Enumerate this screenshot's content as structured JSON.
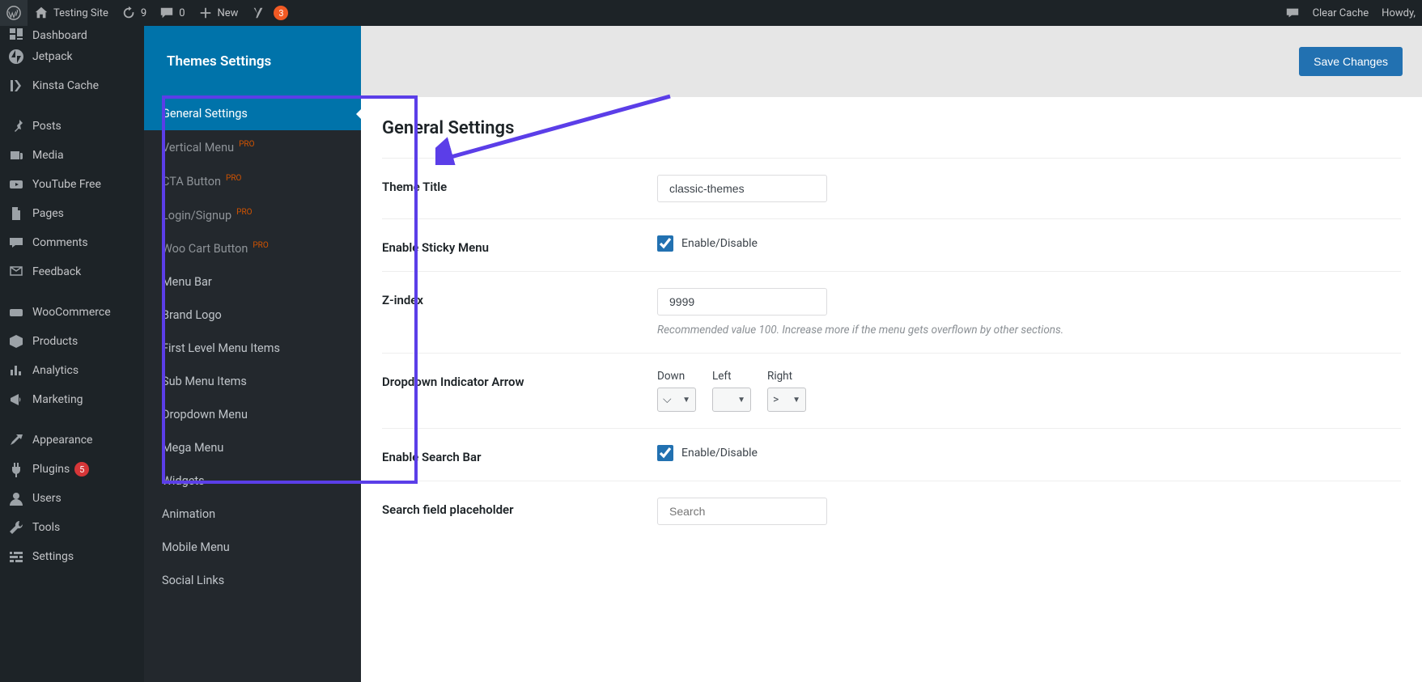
{
  "adminbar": {
    "site_name": "Testing Site",
    "updates_count": "9",
    "comments_count": "0",
    "new_label": "New",
    "yoast_count": "3",
    "clear_cache": "Clear Cache",
    "howdy": "Howdy,"
  },
  "adminmenu": {
    "items": [
      {
        "label": "Dashboard",
        "icon": "dashboard"
      },
      {
        "label": "Jetpack",
        "icon": "jetpack"
      },
      {
        "label": "Kinsta Cache",
        "icon": "kinsta"
      },
      {
        "label": "Posts",
        "icon": "pin"
      },
      {
        "label": "Media",
        "icon": "media"
      },
      {
        "label": "YouTube Free",
        "icon": "youtube"
      },
      {
        "label": "Pages",
        "icon": "pages"
      },
      {
        "label": "Comments",
        "icon": "comments"
      },
      {
        "label": "Feedback",
        "icon": "feedback"
      },
      {
        "label": "WooCommerce",
        "icon": "woo"
      },
      {
        "label": "Products",
        "icon": "products"
      },
      {
        "label": "Analytics",
        "icon": "analytics"
      },
      {
        "label": "Marketing",
        "icon": "marketing"
      },
      {
        "label": "Appearance",
        "icon": "appearance"
      },
      {
        "label": "Plugins",
        "icon": "plugins",
        "badge": "5"
      },
      {
        "label": "Users",
        "icon": "users"
      },
      {
        "label": "Tools",
        "icon": "tools"
      },
      {
        "label": "Settings",
        "icon": "settings"
      }
    ]
  },
  "themes_panel": {
    "title": "Themes Settings",
    "save_button": "Save Changes",
    "tabs": [
      {
        "label": "General Settings",
        "active": true
      },
      {
        "label": "Vertical Menu",
        "pro": true
      },
      {
        "label": "CTA Button",
        "pro": true
      },
      {
        "label": "Login/Signup",
        "pro": true
      },
      {
        "label": "Woo Cart Button",
        "pro": true
      },
      {
        "label": "Menu Bar"
      },
      {
        "label": "Brand Logo"
      },
      {
        "label": "First Level Menu Items"
      },
      {
        "label": "Sub Menu Items"
      },
      {
        "label": "Dropdown Menu"
      },
      {
        "label": "Mega Menu"
      },
      {
        "label": "Widgets"
      },
      {
        "label": "Animation"
      },
      {
        "label": "Mobile Menu"
      },
      {
        "label": "Social Links"
      }
    ],
    "pro_tag": "PRO"
  },
  "general_settings": {
    "heading": "General Settings",
    "theme_title_label": "Theme Title",
    "theme_title_value": "classic-themes",
    "sticky_label": "Enable Sticky Menu",
    "enable_disable": "Enable/Disable",
    "zindex_label": "Z-index",
    "zindex_value": "9999",
    "zindex_hint": "Recommended value 100. Increase more if the menu gets overflown by other sections.",
    "dropdown_arrow_label": "Dropdown Indicator Arrow",
    "arrow_down_label": "Down",
    "arrow_left_label": "Left",
    "arrow_right_label": "Right",
    "arrow_down_glyph": "⌵",
    "arrow_left_glyph": "",
    "arrow_right_glyph": ">",
    "search_bar_label": "Enable Search Bar",
    "search_placeholder_label": "Search field placeholder",
    "search_placeholder_value": "Search"
  }
}
